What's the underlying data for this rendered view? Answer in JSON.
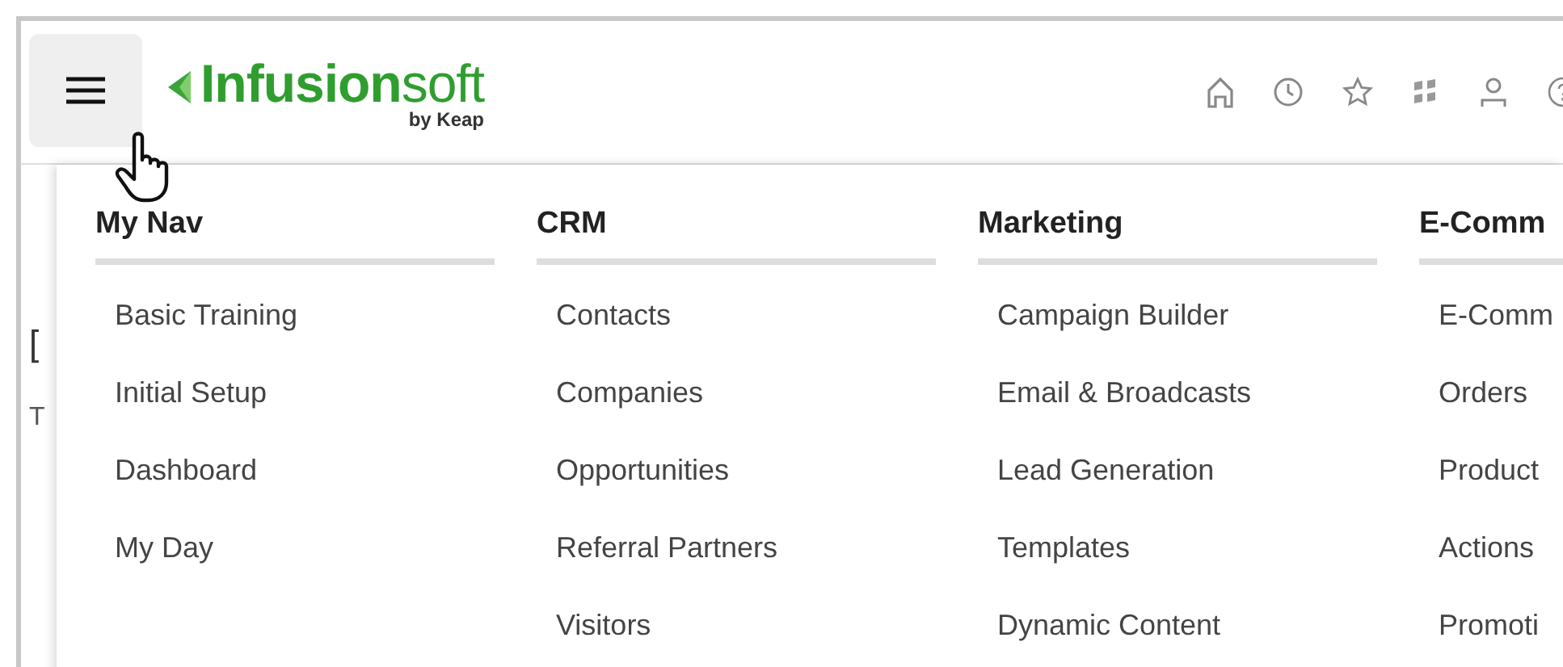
{
  "header": {
    "logo": {
      "brand_bold": "Infusion",
      "brand_light": "soft",
      "tagline": "by Keap"
    }
  },
  "page_behind": [
    "[",
    "T"
  ],
  "menu": {
    "columns": [
      {
        "heading": "My Nav",
        "items": [
          "Basic Training",
          "Initial Setup",
          "Dashboard",
          "My Day"
        ]
      },
      {
        "heading": "CRM",
        "items": [
          "Contacts",
          "Companies",
          "Opportunities",
          "Referral Partners",
          "Visitors"
        ]
      },
      {
        "heading": "Marketing",
        "items": [
          "Campaign Builder",
          "Email & Broadcasts",
          "Lead Generation",
          "Templates",
          "Dynamic Content"
        ]
      },
      {
        "heading": "E-Comm",
        "items": [
          "E-Comm",
          "Orders",
          "Product",
          "Actions",
          "Promoti"
        ]
      }
    ]
  }
}
